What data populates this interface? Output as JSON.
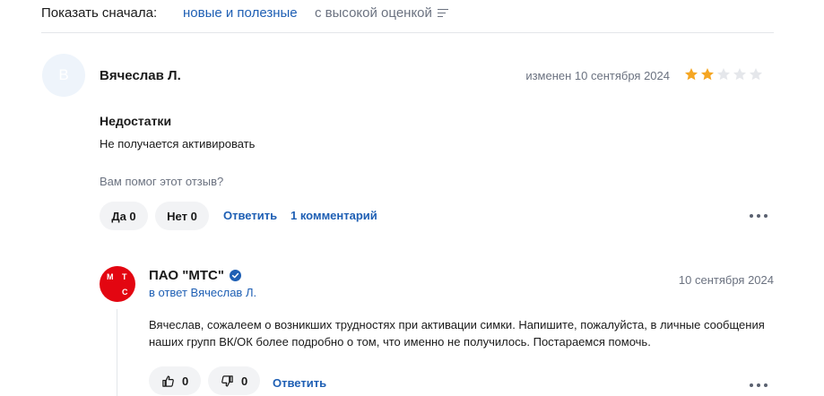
{
  "sort": {
    "label": "Показать сначала:",
    "active_option": "новые и полезные",
    "option": "с высокой оценкой"
  },
  "review": {
    "avatar_letter": "В",
    "author": "Вячеслав Л.",
    "edited": "изменен 10 сентября 2024",
    "rating": 2,
    "rating_max": 5,
    "star_color": "#f5a623",
    "section_title": "Недостатки",
    "section_text": "Не получается активировать",
    "helpful_question": "Вам помог этот отзыв?",
    "yes_label": "Да 0",
    "no_label": "Нет 0",
    "reply_label": "Ответить",
    "comments_label": "1 комментарий"
  },
  "reply": {
    "logo_letters": [
      "М",
      "Т",
      "С"
    ],
    "company": "ПАО \"МТС\"",
    "reply_to": "в ответ Вячеслав Л.",
    "date": "10 сентября 2024",
    "text": "Вячеслав, сожалеем о возникших трудностях при активации симки. Напишите, пожалуйста, в личные сообщения наших групп ВК/ОК более подробно о том, что именно не получилось. Постараемся помочь.",
    "likes": "0",
    "dislikes": "0",
    "reply_label": "Ответить"
  },
  "colors": {
    "link": "#1e5fb4",
    "brand": "#e30611"
  }
}
